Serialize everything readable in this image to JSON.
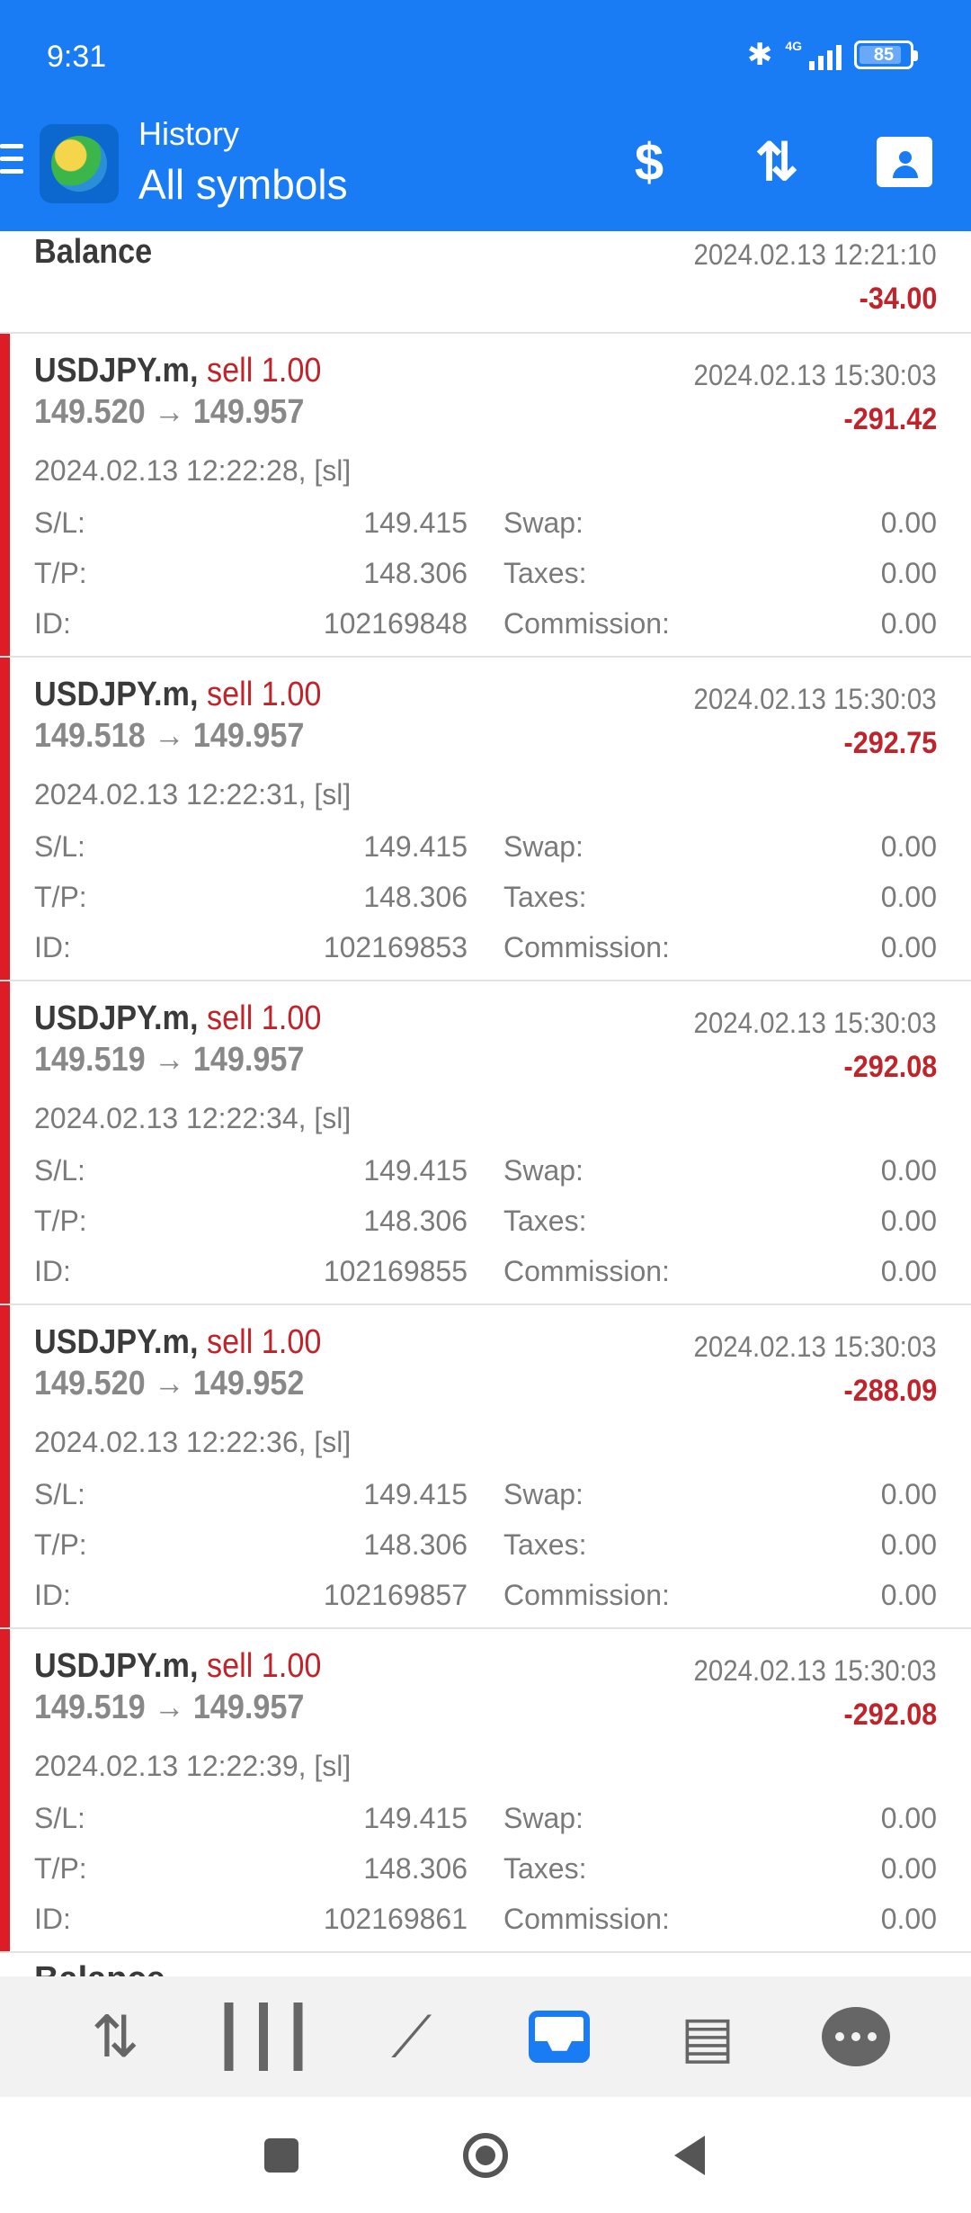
{
  "status_bar": {
    "time": "9:31",
    "network": "4G",
    "battery": "85",
    "battery_level": 0.85
  },
  "header": {
    "title_small": "History",
    "title_big": "All symbols",
    "icons": [
      "currency-exchange-icon",
      "sort-icon",
      "calendar-contact-icon"
    ]
  },
  "balance_top": {
    "label": "Balance",
    "date": "2024.02.13 12:21:10",
    "profit": "-34.00"
  },
  "deals": [
    {
      "symbol": "USDJPY.m,",
      "side": "sell 1.00",
      "prices": "149.520 → 149.957",
      "close_time": "2024.02.13 15:30:03",
      "profit": "-291.42",
      "open_info": "2024.02.13 12:22:28, [sl]",
      "sl": "149.415",
      "tp": "148.306",
      "id": "102169848",
      "swap": "0.00",
      "taxes": "0.00",
      "commission": "0.00"
    },
    {
      "symbol": "USDJPY.m,",
      "side": "sell 1.00",
      "prices": "149.518 → 149.957",
      "close_time": "2024.02.13 15:30:03",
      "profit": "-292.75",
      "open_info": "2024.02.13 12:22:31, [sl]",
      "sl": "149.415",
      "tp": "148.306",
      "id": "102169853",
      "swap": "0.00",
      "taxes": "0.00",
      "commission": "0.00"
    },
    {
      "symbol": "USDJPY.m,",
      "side": "sell 1.00",
      "prices": "149.519 → 149.957",
      "close_time": "2024.02.13 15:30:03",
      "profit": "-292.08",
      "open_info": "2024.02.13 12:22:34, [sl]",
      "sl": "149.415",
      "tp": "148.306",
      "id": "102169855",
      "swap": "0.00",
      "taxes": "0.00",
      "commission": "0.00"
    },
    {
      "symbol": "USDJPY.m,",
      "side": "sell 1.00",
      "prices": "149.520 → 149.952",
      "close_time": "2024.02.13 15:30:03",
      "profit": "-288.09",
      "open_info": "2024.02.13 12:22:36, [sl]",
      "sl": "149.415",
      "tp": "148.306",
      "id": "102169857",
      "swap": "0.00",
      "taxes": "0.00",
      "commission": "0.00"
    },
    {
      "symbol": "USDJPY.m,",
      "side": "sell 1.00",
      "prices": "149.519 → 149.957",
      "close_time": "2024.02.13 15:30:03",
      "profit": "-292.08",
      "open_info": "2024.02.13 12:22:39, [sl]",
      "sl": "149.415",
      "tp": "148.306",
      "id": "102169861",
      "swap": "0.00",
      "taxes": "0.00",
      "commission": "0.00"
    }
  ],
  "labels": {
    "sl": "S/L:",
    "tp": "T/P:",
    "id": "ID:",
    "swap": "Swap:",
    "taxes": "Taxes:",
    "commission": "Commission:"
  },
  "bottom_nav": [
    "quotes-icon",
    "chart-icon",
    "trade-icon",
    "history-icon",
    "news-icon",
    "messages-icon"
  ],
  "colors": {
    "primary": "#1a7cf4",
    "loss": "#c1232b",
    "sell_bar": "#dd1d25"
  }
}
